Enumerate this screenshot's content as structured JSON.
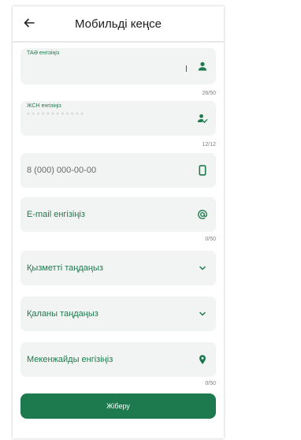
{
  "header": {
    "title": "Мобильді кеңсе",
    "back_icon": "arrow-left-icon"
  },
  "form": {
    "full_name": {
      "label": "ТАӘ енгізіңіз",
      "counter": "26/50",
      "icon": "person-icon"
    },
    "iin": {
      "label": "ЖСН енгізіңіз",
      "counter": "12/12",
      "icon": "person-check-icon"
    },
    "phone": {
      "placeholder": "8 (000) 000-00-00",
      "icon": "smartphone-icon"
    },
    "email": {
      "placeholder": "E-mail енгізіңіз",
      "counter": "0/50",
      "icon": "at-icon"
    },
    "service": {
      "placeholder": "Қызметті таңдаңыз",
      "icon": "chevron-down-icon"
    },
    "city": {
      "placeholder": "Қаланы таңдаңыз",
      "icon": "chevron-down-icon"
    },
    "address": {
      "placeholder": "Мекенжайды енгізіңіз",
      "counter": "0/50",
      "icon": "location-pin-icon"
    },
    "submit_label": "Жіберу"
  },
  "colors": {
    "accent": "#1d7a4f",
    "field_bg": "#f2f3f3"
  }
}
